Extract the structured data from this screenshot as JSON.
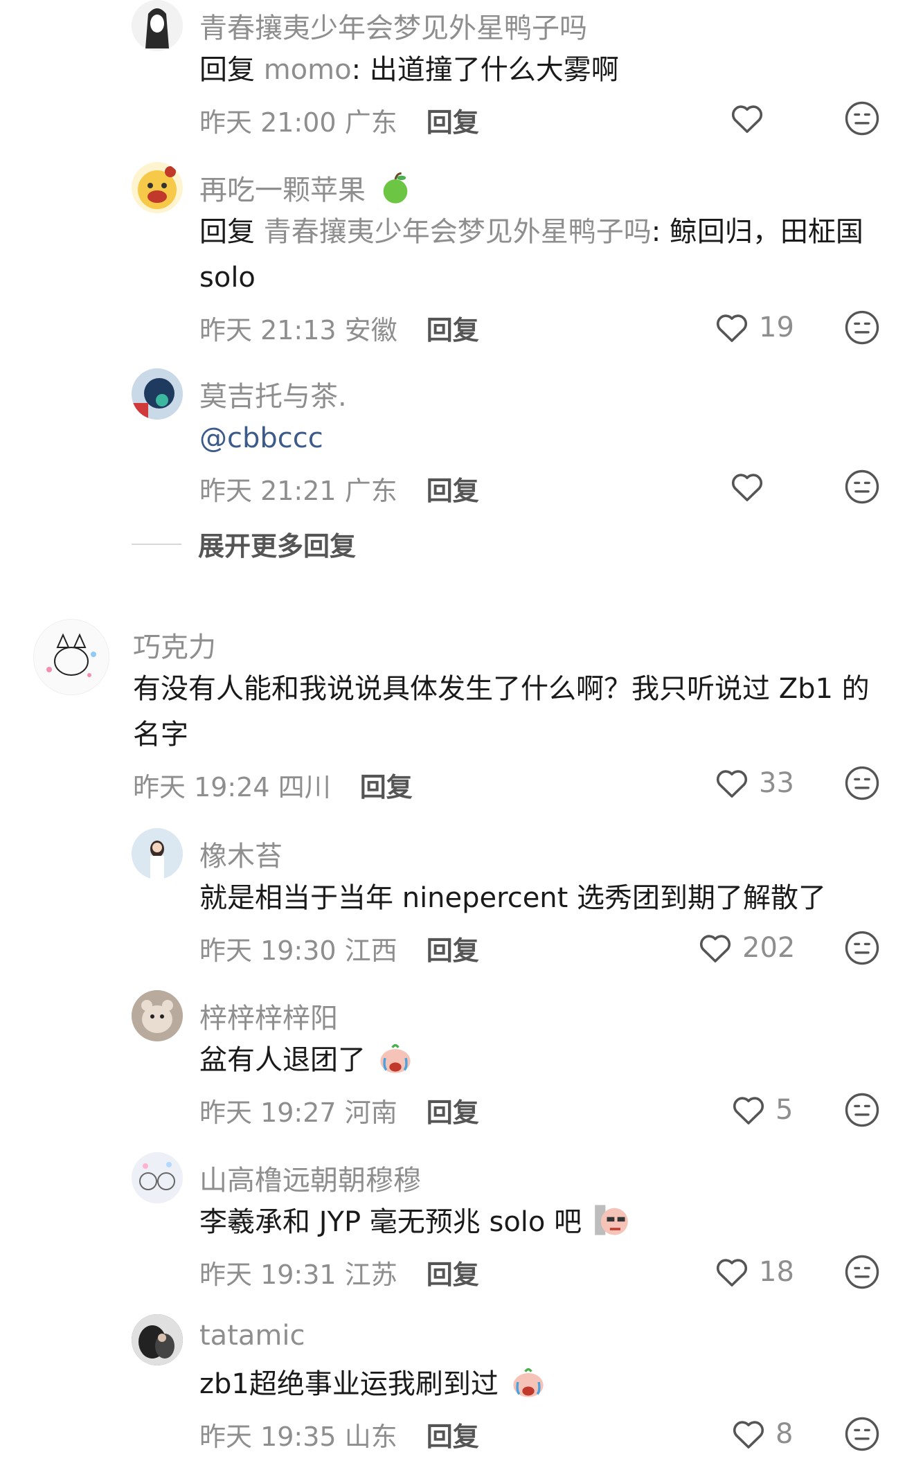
{
  "comments": [
    {
      "username": "青春攘夷少年会梦见外星鸭子吗",
      "reply_prefix": "回复 ",
      "reply_target": "momo",
      "text": ": 出道撞了什么大雾啊",
      "time": "昨天 21:00",
      "location": "广东",
      "reply_label": "回复",
      "likes": ""
    },
    {
      "username": "再吃一颗苹果",
      "reply_prefix": "回复 ",
      "reply_target": "青春攘夷少年会梦见外星鸭子吗",
      "text": ": 鲸回归，田柾国 solo",
      "time": "昨天 21:13",
      "location": "安徽",
      "reply_label": "回复",
      "likes": "19"
    },
    {
      "username": "莫吉托与茶.",
      "mention": "@cbbccc",
      "time": "昨天 21:21",
      "location": "广东",
      "reply_label": "回复",
      "likes": ""
    },
    {
      "expand_label": "展开更多回复"
    },
    {
      "username": "巧克力",
      "text": "有没有人能和我说说具体发生了什么啊？我只听说过 Zb1 的名字",
      "time": "昨天 19:24",
      "location": "四川",
      "reply_label": "回复",
      "likes": "33"
    },
    {
      "username": "橡木苔",
      "text": "就是相当于当年 ninepercent 选秀团到期了解散了",
      "time": "昨天 19:30",
      "location": "江西",
      "reply_label": "回复",
      "likes": "202"
    },
    {
      "username": "梓梓梓梓阳",
      "text": "盆有人退团了",
      "time": "昨天 19:27",
      "location": "河南",
      "reply_label": "回复",
      "likes": "5"
    },
    {
      "username": "山高橹远朝朝穆穆",
      "text": "李羲承和 JYP 毫无预兆 solo 吧",
      "time": "昨天 19:31",
      "location": "江苏",
      "reply_label": "回复",
      "likes": "18"
    },
    {
      "username": "tatamic",
      "text": "zb1超绝事业运我刷到过",
      "time": "昨天 19:35",
      "location": "山东",
      "reply_label": "回复",
      "likes": "8"
    }
  ],
  "colors": {
    "secondary_text": "#8e8e8e",
    "mention": "#3c5a8a"
  },
  "icons": {
    "like": "heart-outline-icon",
    "dislike": "neutral-face-icon"
  }
}
